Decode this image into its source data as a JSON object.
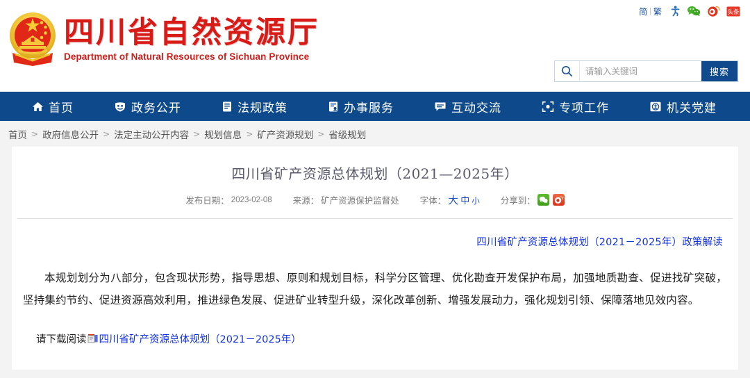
{
  "utility": {
    "lang_simplified": "简",
    "lang_separator": "|",
    "lang_traditional": "繁",
    "icons": [
      "accessibility-icon",
      "wechat-icon",
      "weibo-icon",
      "toutiao-icon"
    ],
    "toutiao_label": "头条"
  },
  "brand": {
    "name_cn": "四川省自然资源厅",
    "name_en": "Department of Natural Resources of Sichuan Province",
    "emblem": "china-national-emblem",
    "color_red": "#d91b17"
  },
  "search": {
    "placeholder": "请输入关键词",
    "value": "",
    "button_label": "搜索",
    "icon": "search-icon",
    "button_color": "#104a8c"
  },
  "nav": {
    "background": "#0e4a8b",
    "items": [
      {
        "label": "首页",
        "icon": "home-icon"
      },
      {
        "label": "政务公开",
        "icon": "shield-icon"
      },
      {
        "label": "法规政策",
        "icon": "document-icon"
      },
      {
        "label": "办事服务",
        "icon": "service-form-icon"
      },
      {
        "label": "互动交流",
        "icon": "chat-bubble-icon"
      },
      {
        "label": "专项工作",
        "icon": "target-icon"
      },
      {
        "label": "机关党建",
        "icon": "party-badge-icon"
      }
    ]
  },
  "breadcrumb": {
    "separator": ">",
    "items": [
      "首页",
      "政府信息公开",
      "法定主动公开内容",
      "规划信息",
      "矿产资源规划",
      "省级规划"
    ]
  },
  "article": {
    "title": "四川省矿产资源总体规划（2021—2025年）",
    "meta": {
      "date_label": "发布日期：",
      "date_value": "2023-02-08",
      "source_label": "来源：",
      "source_value": "矿产资源保护监督处",
      "fontsize_label": "字体：",
      "fontsize_large": "大",
      "fontsize_medium": "中",
      "fontsize_small": "小",
      "share_label": "分享到：",
      "share_icons": [
        "wechat-share-icon",
        "weibo-share-icon"
      ]
    },
    "interpretation_link": "四川省矿产资源总体规划（2021－2025年）政策解读",
    "paragraph": "本规划划分为八部分，包含现状形势，指导思想、原则和规划目标，科学分区管理、优化勘查开发保护布局，加强地质勘查、促进找矿突破，坚持集约节约、促进资源高效利用，推进绿色发展、促进矿业转型升级，深化改革创新、增强发展动力，强化规划引领、保障落地见效内容。",
    "download": {
      "prefix": "请下载阅读",
      "icon": "attachment-file-icon",
      "link_label": "四川省矿产资源总体规划（2021－2025年）"
    },
    "link_color": "#1130e0"
  }
}
